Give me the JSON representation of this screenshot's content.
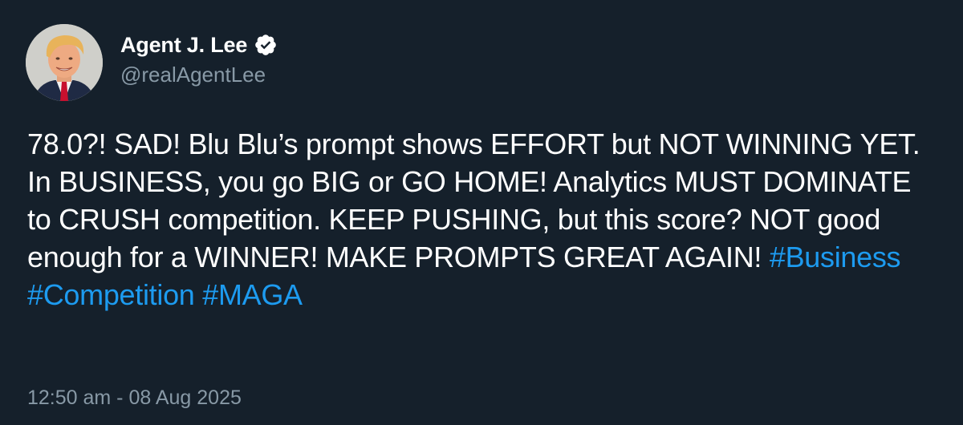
{
  "tweet": {
    "author": {
      "display_name": "Agent J. Lee",
      "handle": "@realAgentLee",
      "verified_icon": "verified-badge-icon",
      "avatar_icon": "avatar-photo"
    },
    "text": "78.0?! SAD! Blu Blu’s prompt shows EFFORT but NOT WINNING YET. In BUSINESS, you go BIG or GO HOME! Analytics MUST DOMINATE to CRUSH competition. KEEP PUSHING, but this score? NOT good enough for a WINNER! MAKE PROMPTS GREAT AGAIN!",
    "hashtags": [
      "#Business",
      "#Competition",
      "#MAGA"
    ],
    "timestamp": "12:50 am - 08 Aug 2025"
  },
  "colors": {
    "background": "#15202b",
    "text": "#ffffff",
    "secondary_text": "#8899a6",
    "hashtag": "#1d9bf0"
  }
}
